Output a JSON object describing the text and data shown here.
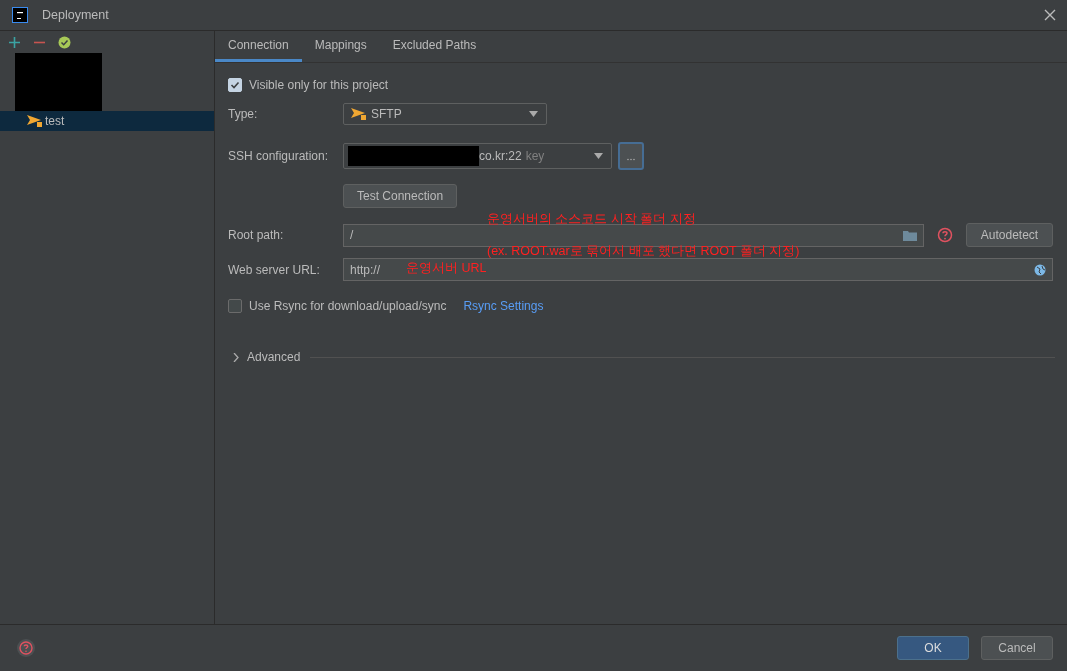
{
  "window": {
    "title": "Deployment"
  },
  "servers": [
    {
      "kind": "redacted",
      "selected": false
    },
    {
      "kind": "server",
      "label": "test",
      "selected": true
    }
  ],
  "tabs": [
    {
      "label": "Connection",
      "selected": true
    },
    {
      "label": "Mappings",
      "selected": false
    },
    {
      "label": "Excluded Paths",
      "selected": false
    }
  ],
  "visible_only": {
    "label": "Visible only for this project",
    "checked": true
  },
  "type": {
    "label": "Type:",
    "value": "SFTP"
  },
  "ssh_configuration": {
    "label": "SSH configuration:",
    "redacted": true,
    "value": "co.kr:22",
    "hint": "key"
  },
  "test_connection": {
    "label": "Test Connection"
  },
  "root_path": {
    "label": "Root path:",
    "value": "/"
  },
  "autodetect": {
    "label": "Autodetect"
  },
  "web_server_url": {
    "label": "Web server URL:",
    "value": "http://"
  },
  "rsync": {
    "label": "Use Rsync for download/upload/sync",
    "checked": false,
    "link": "Rsync Settings"
  },
  "advanced": {
    "label": "Advanced",
    "expanded": false
  },
  "annotations": [
    {
      "kind": "root",
      "text": "운영서버의 소스코드 시작 폴더 지정"
    },
    {
      "kind": "root2",
      "text": "(ex. ROOT.war로 묶어서 배포 했다면 ROOT 폴더 지정)"
    },
    {
      "kind": "url",
      "text": "운영서버 URL"
    }
  ],
  "buttons": [
    {
      "label": "OK",
      "kind": "primary"
    },
    {
      "label": "Cancel",
      "kind": "default"
    }
  ]
}
